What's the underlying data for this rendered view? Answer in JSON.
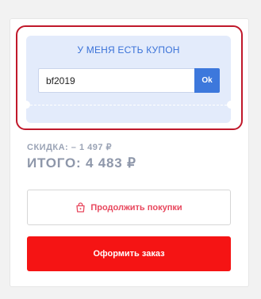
{
  "coupon": {
    "title": "У МЕНЯ ЕСТЬ КУПОН",
    "input_value": "bf2019",
    "apply_label": "Ok"
  },
  "summary": {
    "discount": "СКИДКА: – 1 497 ₽",
    "total": "ИТОГО: 4 483 ₽"
  },
  "actions": {
    "continue_label": "Продолжить покупки",
    "order_label": "Оформить заказ"
  },
  "colors": {
    "accent_blue": "#3d78dc",
    "order_red": "#f51414",
    "highlight_red": "#c0182a",
    "coupon_bg": "#e3ebfb"
  },
  "icons": {
    "continue": "shopping-bag-icon"
  }
}
